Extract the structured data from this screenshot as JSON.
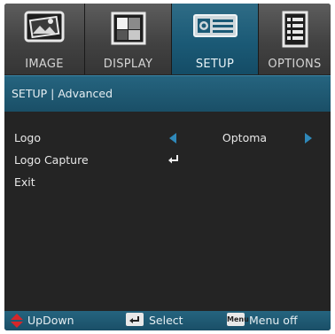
{
  "tabs": [
    {
      "label": "IMAGE",
      "icon": "image-icon",
      "active": false
    },
    {
      "label": "DISPLAY",
      "icon": "display-icon",
      "active": false
    },
    {
      "label": "SETUP",
      "icon": "setup-icon",
      "active": true
    },
    {
      "label": "OPTIONS",
      "icon": "options-icon",
      "active": false
    }
  ],
  "header": {
    "title": "SETUP | Advanced"
  },
  "menu": {
    "items": [
      {
        "label": "Logo",
        "value": "Optoma"
      },
      {
        "label": "Logo Capture"
      },
      {
        "label": "Exit"
      }
    ]
  },
  "footer": {
    "updown_label": "UpDown",
    "select_label": "Select",
    "menu_key_text": "Menu",
    "menu_label": "Menu off"
  },
  "colors": {
    "accent": "#1b5a76",
    "arrow": "#2f88b9",
    "updown_icon": "#d6262a",
    "background": "#242424"
  }
}
